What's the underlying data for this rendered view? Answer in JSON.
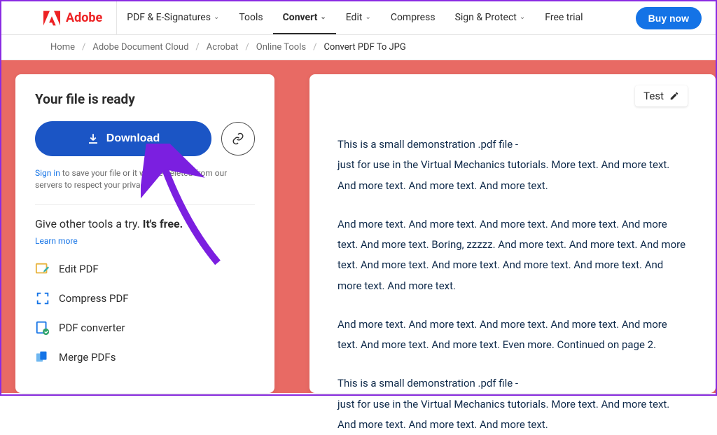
{
  "brand": {
    "name": "Adobe"
  },
  "nav": {
    "items": [
      {
        "label": "PDF & E-Signatures",
        "chevron": true,
        "active": false
      },
      {
        "label": "Tools",
        "chevron": false,
        "active": false
      },
      {
        "label": "Convert",
        "chevron": true,
        "active": true
      },
      {
        "label": "Edit",
        "chevron": true,
        "active": false
      },
      {
        "label": "Compress",
        "chevron": false,
        "active": false
      },
      {
        "label": "Sign & Protect",
        "chevron": true,
        "active": false
      },
      {
        "label": "Free trial",
        "chevron": false,
        "active": false
      }
    ],
    "buy": "Buy now"
  },
  "breadcrumbs": {
    "items": [
      "Home",
      "Adobe Document Cloud",
      "Acrobat",
      "Online Tools"
    ],
    "current": "Convert PDF To JPG"
  },
  "ready": {
    "title": "Your file is ready",
    "download": "Download",
    "signin_prefix": "Sign in",
    "privacy_text": " to save your file or it will be deleted from our servers to respect your privacy."
  },
  "tools": {
    "heading_prefix": "Give other tools a try. ",
    "heading_strong": "It's free.",
    "learn_more": "Learn more",
    "items": [
      "Edit PDF",
      "Compress PDF",
      "PDF converter",
      "Merge PDFs"
    ]
  },
  "preview": {
    "filename": "Test",
    "paragraphs": [
      "This is a small demonstration .pdf file -\njust for use in the Virtual Mechanics tutorials. More text. And more text. And more text. And more text. And more text.",
      "And more text. And more text. And more text. And more text. And more text. And more text. Boring, zzzzz. And more text. And more text. And more text. And more text. And more text. And more text. And more text. And more text. And more text.",
      "And more text. And more text. And more text. And more text. And more text. And more text. And more text. Even more. Continued on page 2.",
      "This is a small demonstration .pdf file -\njust for use in the Virtual Mechanics tutorials. More text. And more text. And more text. And more text. And more text."
    ]
  }
}
